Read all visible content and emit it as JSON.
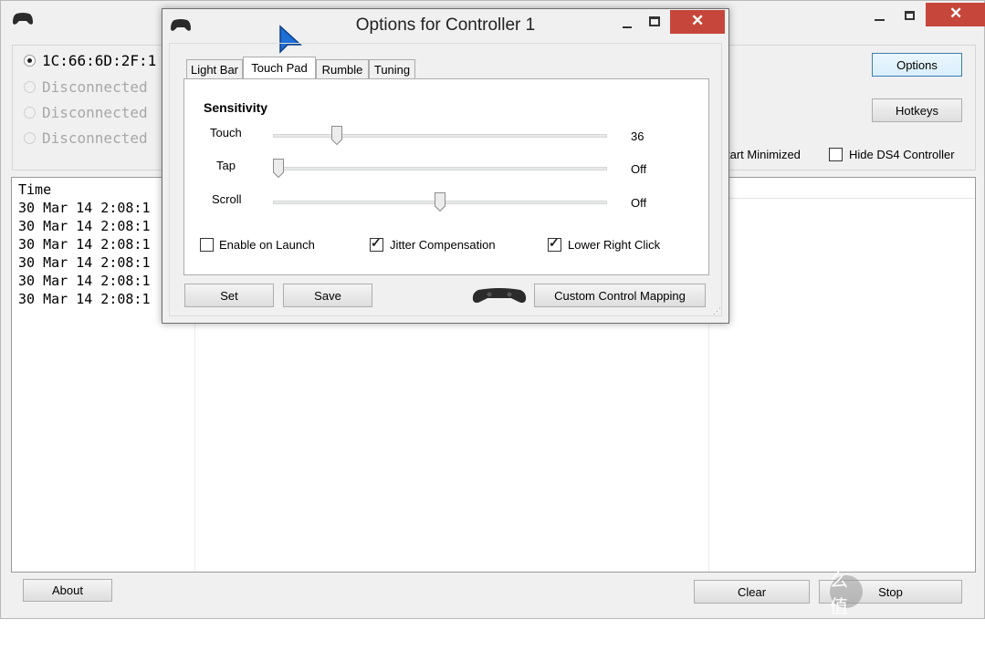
{
  "main": {
    "controllers": [
      {
        "label": "1C:66:6D:2F:1",
        "selected": true,
        "enabled": true
      },
      {
        "label": "Disconnected",
        "selected": false,
        "enabled": false
      },
      {
        "label": "Disconnected",
        "selected": false,
        "enabled": false
      },
      {
        "label": "Disconnected",
        "selected": false,
        "enabled": false
      }
    ],
    "options_label": "Options",
    "hotkeys_label": "Hotkeys",
    "start_minimized_label": "tart Minimized",
    "hide_ds4_label": "Hide DS4 Controller",
    "log_header": "Time",
    "log_rows": [
      "30 Mar 14 2:08:1",
      "30 Mar 14 2:08:1",
      "30 Mar 14 2:08:1",
      "30 Mar 14 2:08:1",
      "30 Mar 14 2:08:1",
      "30 Mar 14 2:08:1"
    ],
    "about_label": "About",
    "clear_label": "Clear",
    "stop_label": "Stop"
  },
  "dialog": {
    "title": "Options for Controller 1",
    "tabs": [
      "Light Bar",
      "Touch Pad",
      "Rumble",
      "Tuning"
    ],
    "active_tab": "Touch Pad",
    "section_title": "Sensitivity",
    "sliders": [
      {
        "label": "Touch",
        "value": "36",
        "level": 0.18
      },
      {
        "label": "Tap",
        "value": "Off",
        "level": 0.0
      },
      {
        "label": "Scroll",
        "value": "Off",
        "level": 0.5
      }
    ],
    "checkboxes": [
      {
        "label": "Enable on Launch",
        "checked": false
      },
      {
        "label": "Jitter Compensation",
        "checked": true
      },
      {
        "label": "Lower Right Click",
        "checked": true
      }
    ],
    "set_label": "Set",
    "save_label": "Save",
    "custom_mapping_label": "Custom Control Mapping"
  },
  "watermark": "值 什么值得买",
  "colors": {
    "close_red": "#c7463b",
    "accent_blue": "#1e6fd6"
  }
}
